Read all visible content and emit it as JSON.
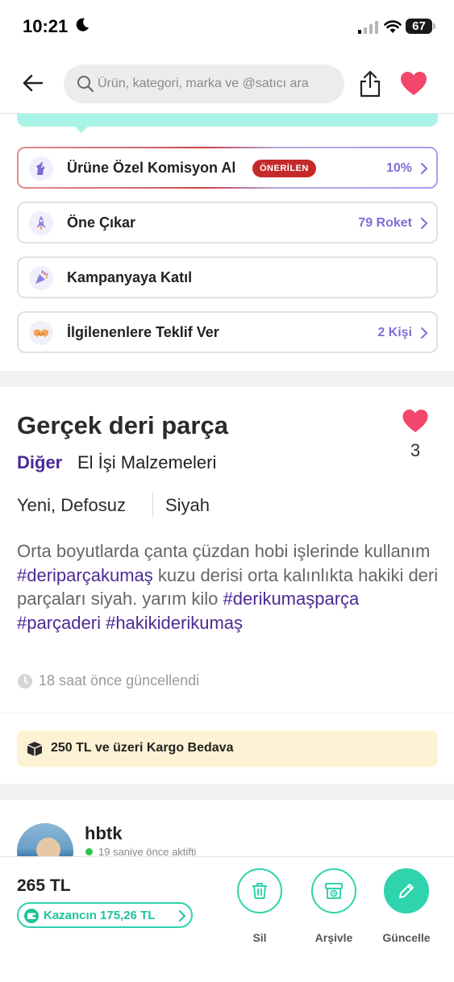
{
  "status_bar": {
    "time": "10:21",
    "battery": "67"
  },
  "header": {
    "search_placeholder": "Ürün, kategori, marka ve @satıcı ara"
  },
  "actions": [
    {
      "label": "Ürüne Özel Komisyon Al",
      "badge": "ÖNERİLEN",
      "value": "10%"
    },
    {
      "label": "Öne Çıkar",
      "value": "79 Roket"
    },
    {
      "label": "Kampanyaya Katıl"
    },
    {
      "label": "İlgilenenlere Teklif Ver",
      "value": "2 Kişi"
    }
  ],
  "product": {
    "title": "Gerçek deri parça",
    "likes": "3",
    "category_primary": "Diğer",
    "category_secondary": "El İşi Malzemeleri",
    "condition": "Yeni, Defosuz",
    "color": "Siyah",
    "description": {
      "part1": "Orta boyutlarda çanta çüzdan hobi işlerinde kullanım ",
      "tag1": "#deriparçakumaş",
      "part2": " kuzu derisi orta kalınlıkta hakiki deri parçaları siyah. yarım kilo ",
      "tag2": "#derikumaşparça",
      "tag3": "#parçaderi",
      "tag4": "#hakikiderikumaş"
    },
    "updated": "18 saat önce güncellendi",
    "shipping_note": "250 TL ve üzeri Kargo Bedava"
  },
  "seller": {
    "username": "hbtk",
    "status": "19 saniye önce aktifti"
  },
  "bottom_bar": {
    "price": "265 TL",
    "earnings": "Kazancın 175,26 TL",
    "buttons": {
      "delete": "Sil",
      "archive": "Arşivle",
      "update": "Güncelle"
    }
  },
  "colors": {
    "accent": "#2fd3ad",
    "brand_purple": "#4b2a95",
    "heart": "#f2476a",
    "badge_red": "#c52a2a"
  }
}
